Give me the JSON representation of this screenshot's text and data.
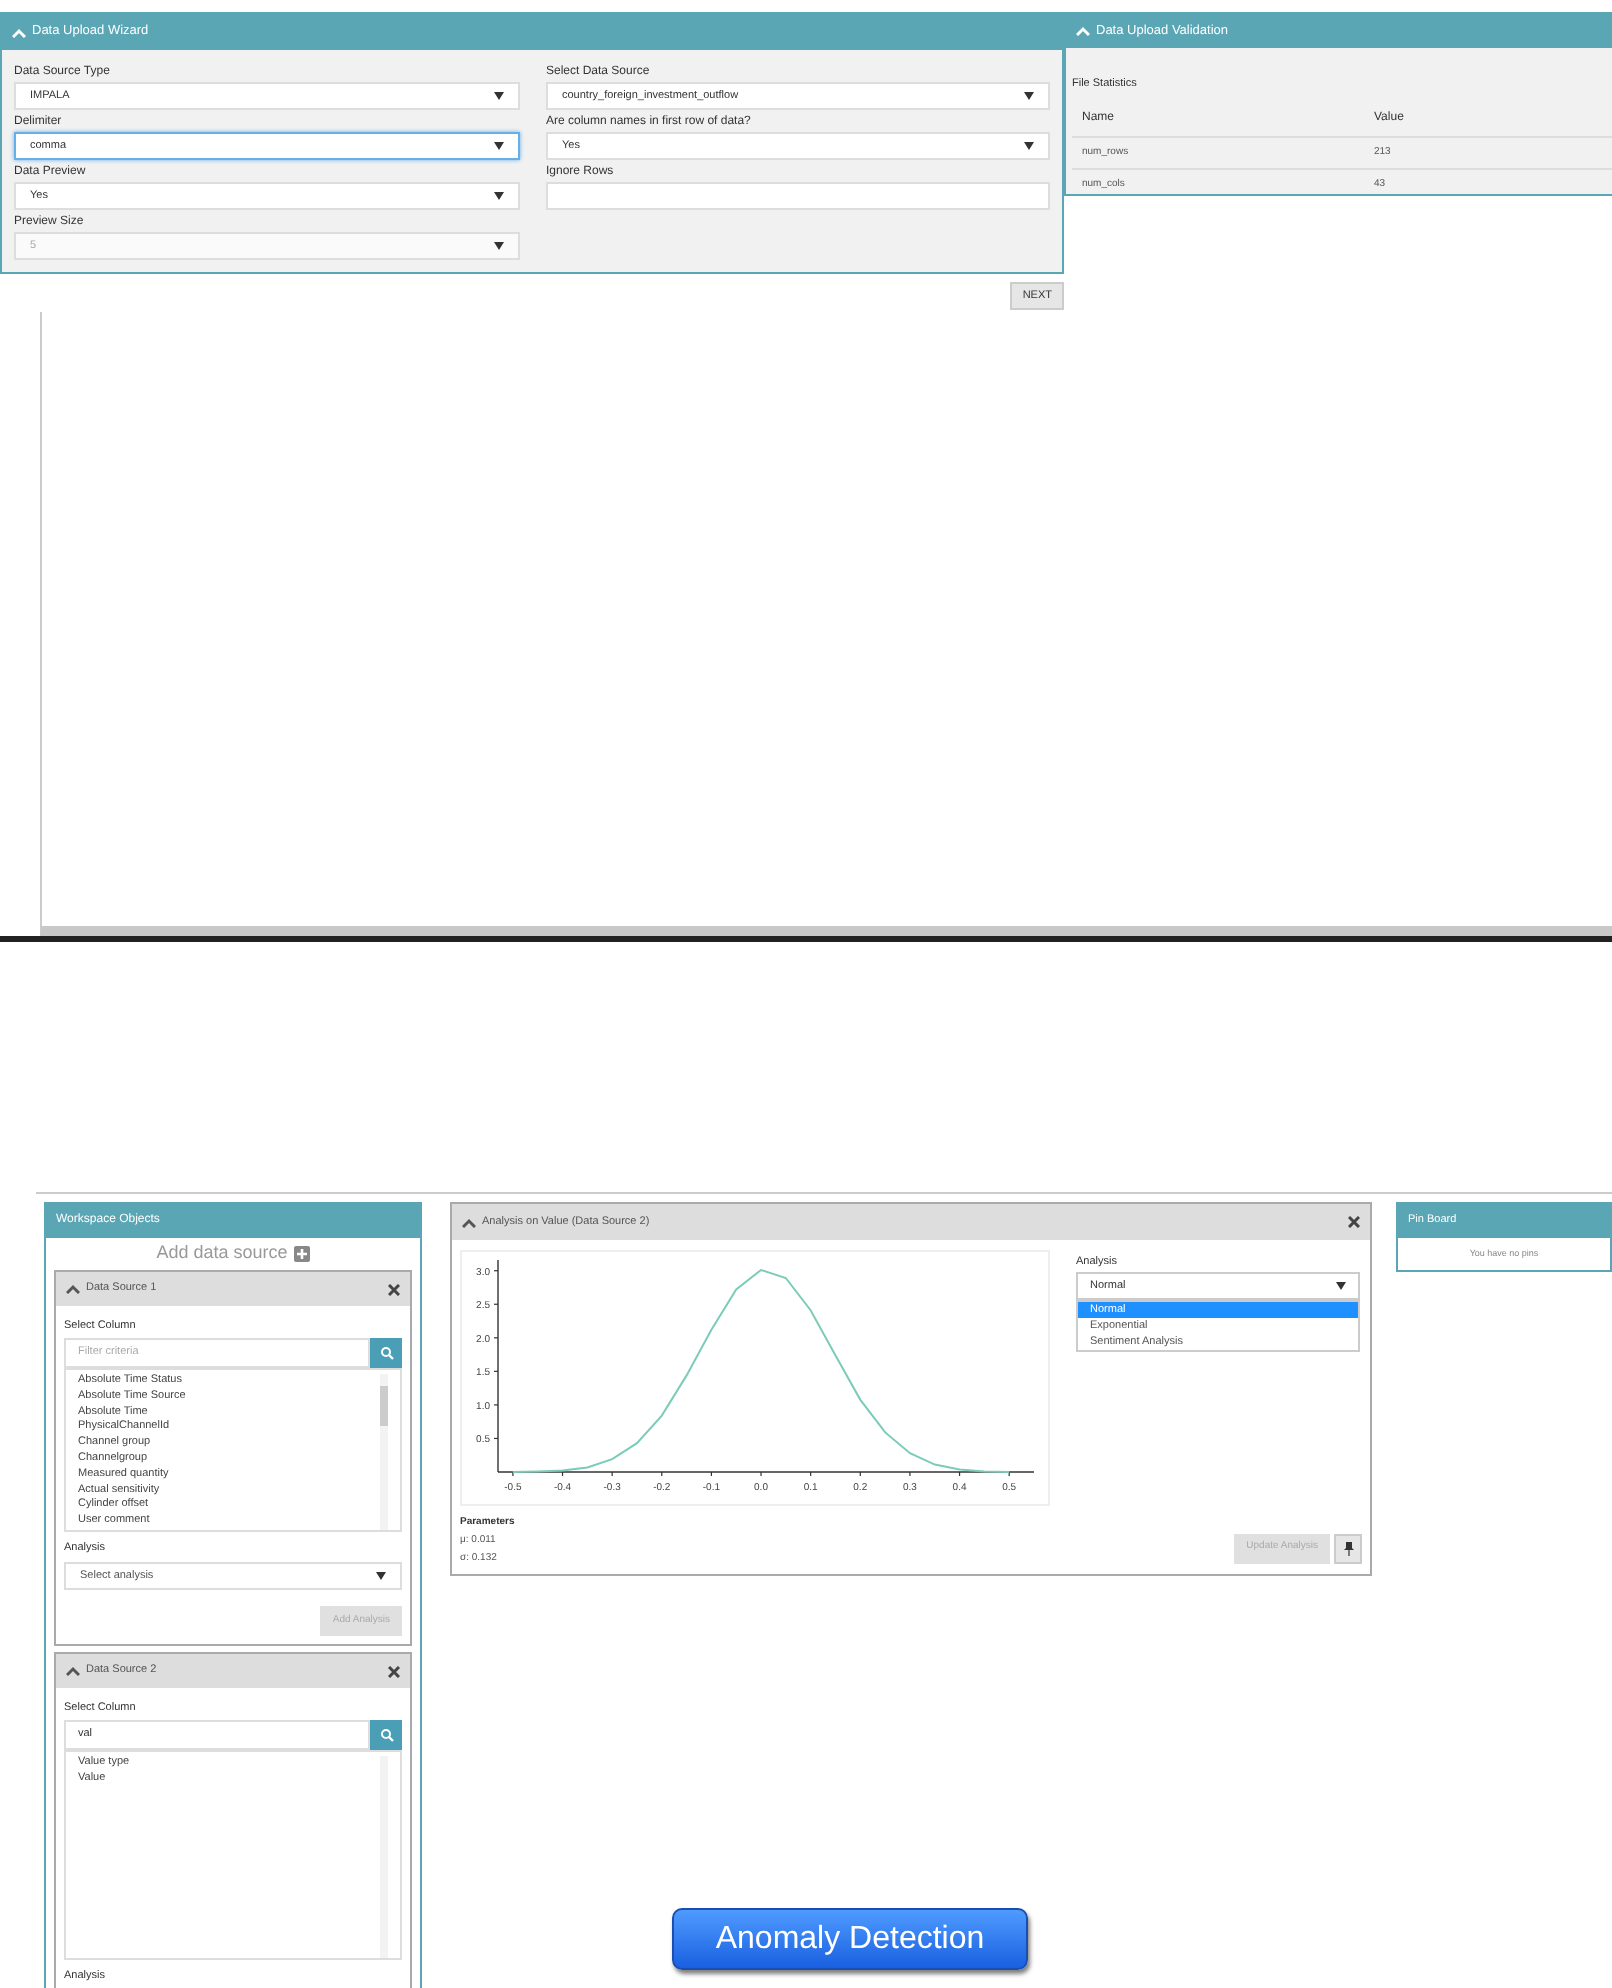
{
  "wizard": {
    "title": "Data Upload Wizard",
    "left_fields": [
      {
        "label": "Data Source Type",
        "value": "IMPALA",
        "kind": "select",
        "focused": false,
        "disabled": false
      },
      {
        "label": "Delimiter",
        "value": "comma",
        "kind": "select",
        "focused": true,
        "disabled": false
      },
      {
        "label": "Data Preview",
        "value": "Yes",
        "kind": "select",
        "focused": false,
        "disabled": false
      },
      {
        "label": "Preview Size",
        "value": "5",
        "kind": "select",
        "focused": false,
        "disabled": true
      }
    ],
    "right_fields": [
      {
        "label": "Select Data Source",
        "value": "country_foreign_investment_outflow",
        "kind": "select"
      },
      {
        "label": "Are column names in first row of data?",
        "value": "Yes",
        "kind": "select"
      },
      {
        "label": "Ignore Rows",
        "kind": "input"
      }
    ],
    "next_button": "NEXT"
  },
  "validation": {
    "title": "Data Upload Validation",
    "subtitle": "File Statistics",
    "columns": [
      "Name",
      "Value"
    ],
    "rows": [
      [
        "num_rows",
        "213"
      ],
      [
        "num_cols",
        "43"
      ]
    ]
  },
  "workspace": {
    "title": "Workspace Objects",
    "add_label": "Add data source",
    "sources": [
      {
        "title": "Data Source 1",
        "column_label": "Select Column",
        "search_placeholder": "Filter criteria",
        "items": [
          "Absolute Time Status",
          "Absolute Time Source",
          "Absolute Time",
          "PhysicalChannelId",
          "Channel group",
          "Channelgroup",
          "Measured quantity",
          "Actual sensitivity",
          "Cylinder offset",
          "User comment"
        ],
        "analysis_label": "Analysis",
        "analysis_placeholder": "Select analysis",
        "add_button": "Add Analysis"
      },
      {
        "title": "Data Source 2",
        "column_label": "Select Column",
        "search_value": "val",
        "items": [
          "Value type",
          "Value"
        ],
        "analysis_label": "Analysis"
      }
    ]
  },
  "analysis": {
    "title": "Analysis on Value (Data Source 2)",
    "chart_data": {
      "type": "line",
      "x": [
        -0.5,
        -0.45,
        -0.4,
        -0.35,
        -0.3,
        -0.25,
        -0.2,
        -0.15,
        -0.1,
        -0.05,
        0,
        0.05,
        0.1,
        0.15,
        0.2,
        0.25,
        0.3,
        0.35,
        0.4,
        0.45,
        0.5
      ],
      "series": [
        {
          "color": "#7ccbb8",
          "values": [
            0,
            0.01,
            0.02,
            0.07,
            0.19,
            0.43,
            0.84,
            1.44,
            2.12,
            2.72,
            3.01,
            2.89,
            2.41,
            1.74,
            1.08,
            0.59,
            0.28,
            0.11,
            0.04,
            0.01,
            0
          ]
        }
      ],
      "xticks": [
        {
          "value": -0.5,
          "label": "-0.5"
        },
        {
          "value": -0.4,
          "label": "-0.4"
        },
        {
          "value": -0.3,
          "label": "-0.3"
        },
        {
          "value": -0.2,
          "label": "-0.2"
        },
        {
          "value": -0.1,
          "label": "-0.1"
        },
        {
          "value": 0,
          "label": "0.0"
        },
        {
          "value": 0.1,
          "label": "0.1"
        },
        {
          "value": 0.2,
          "label": "0.2"
        },
        {
          "value": 0.3,
          "label": "0.3"
        },
        {
          "value": 0.4,
          "label": "0.4"
        },
        {
          "value": 0.5,
          "label": "0.5"
        }
      ],
      "yticks": [
        {
          "value": 0.5,
          "label": "0.5"
        },
        {
          "value": 1,
          "label": "1.0"
        },
        {
          "value": 1.5,
          "label": "1.5"
        },
        {
          "value": 2,
          "label": "2.0"
        },
        {
          "value": 2.5,
          "label": "2.5"
        },
        {
          "value": 3,
          "label": "3.0"
        }
      ],
      "xlim": [
        -0.53,
        0.55
      ],
      "ylim": [
        0,
        3.1
      ]
    },
    "parameters_label": "Parameters",
    "parameters": [
      "μ: 0.011",
      "σ: 0.132"
    ],
    "analysis_label": "Analysis",
    "analysis_value": "Normal",
    "options": [
      {
        "label": "Normal",
        "selected": true
      },
      {
        "label": "Exponential",
        "selected": false
      },
      {
        "label": "Sentiment Analysis",
        "selected": false
      }
    ],
    "update_button": "Update Analysis"
  },
  "pin_board": {
    "title": "Pin Board",
    "empty_text": "You have no pins"
  },
  "caption_button": "Anomaly Detection"
}
